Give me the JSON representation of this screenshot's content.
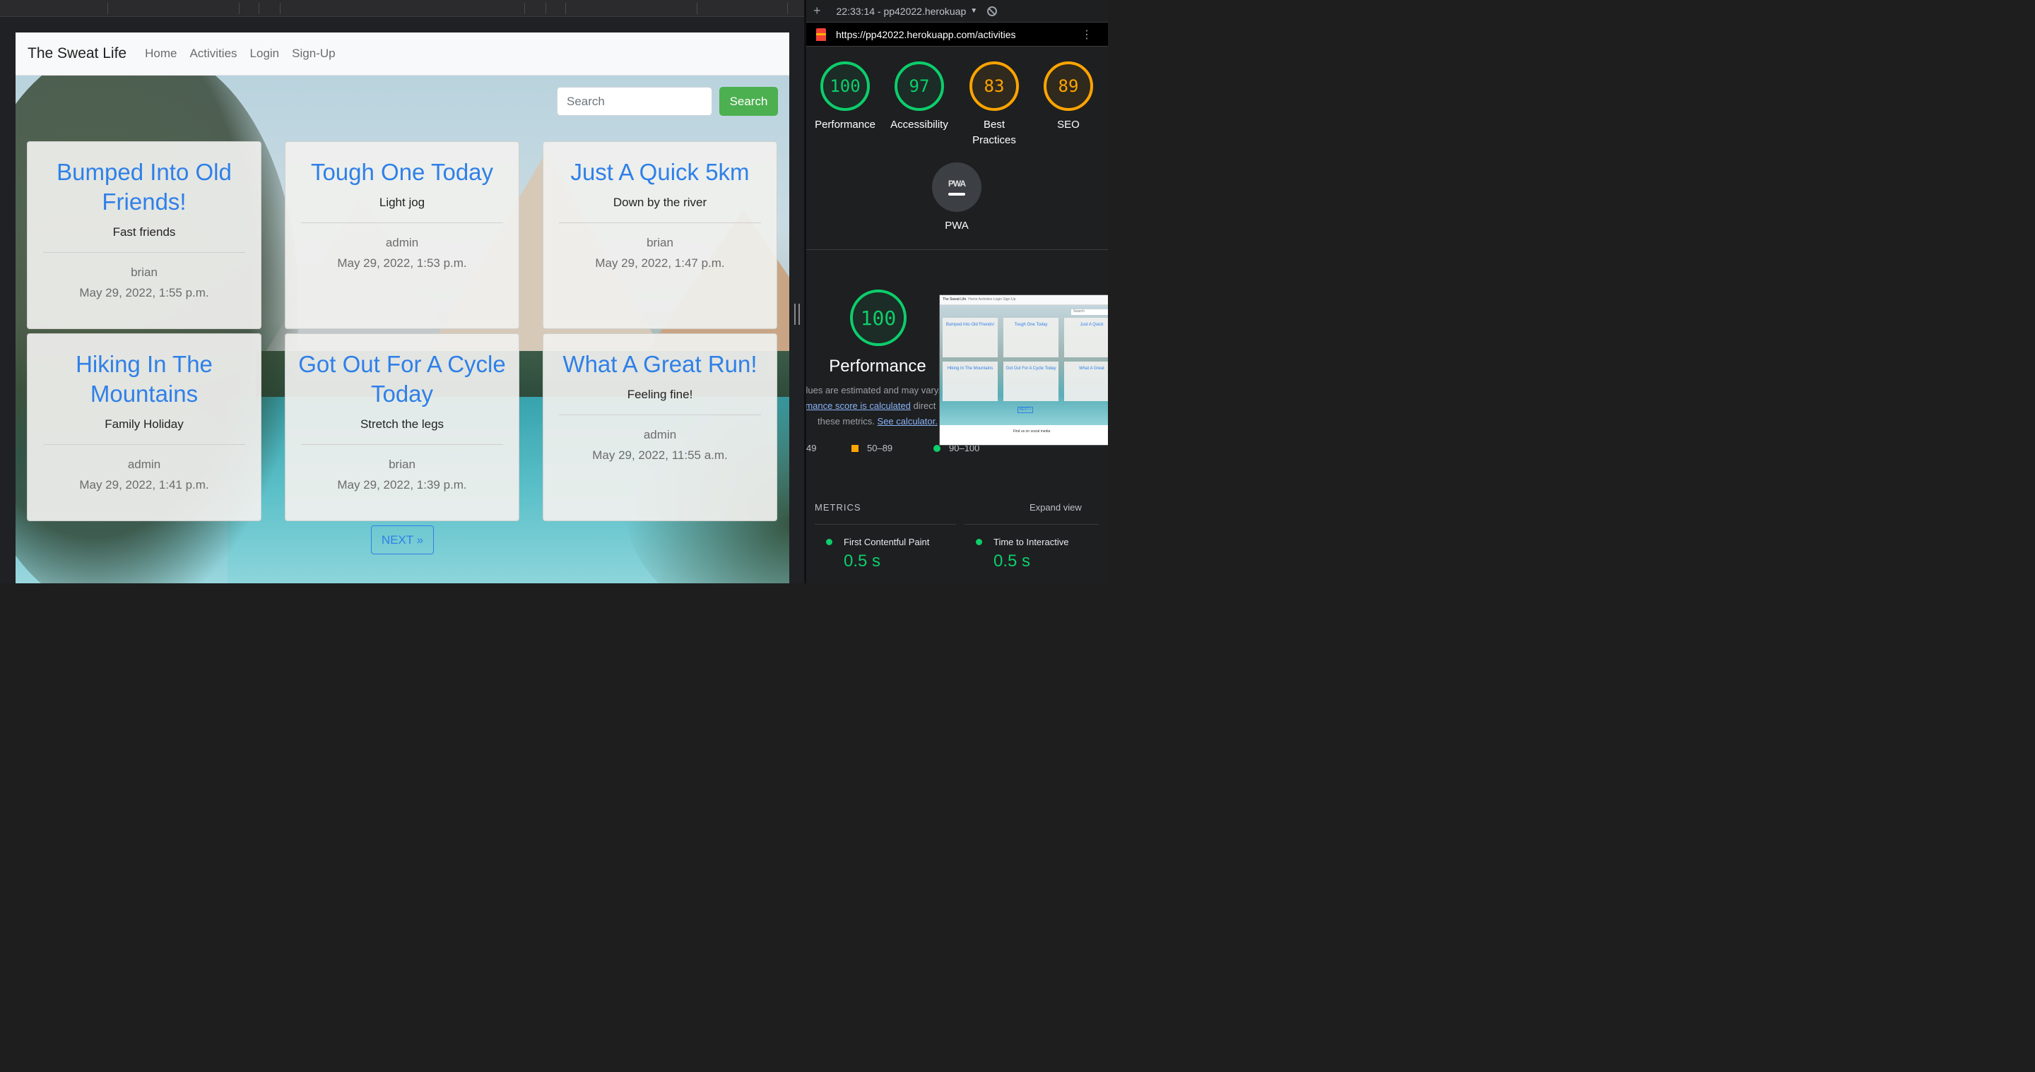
{
  "app": {
    "brand": "The Sweat Life",
    "nav": [
      "Home",
      "Activities",
      "Login",
      "Sign-Up"
    ],
    "search": {
      "placeholder": "Search",
      "button_label": "Search"
    },
    "cards": [
      {
        "title": "Bumped Into Old Friends!",
        "subtitle": "Fast friends",
        "author": "brian",
        "date": "May 29, 2022, 1:55 p.m."
      },
      {
        "title": "Tough One Today",
        "subtitle": "Light jog",
        "author": "admin",
        "date": "May 29, 2022, 1:53 p.m."
      },
      {
        "title": "Just A Quick 5km",
        "subtitle": "Down by the river",
        "author": "brian",
        "date": "May 29, 2022, 1:47 p.m."
      },
      {
        "title": "Hiking In The Mountains",
        "subtitle": "Family Holiday",
        "author": "admin",
        "date": "May 29, 2022, 1:41 p.m."
      },
      {
        "title": "Got Out For A Cycle Today",
        "subtitle": "Stretch the legs",
        "author": "brian",
        "date": "May 29, 2022, 1:39 p.m."
      },
      {
        "title": "What A Great Run!",
        "subtitle": "Feeling fine!",
        "author": "admin",
        "date": "May 29, 2022, 11:55 a.m."
      }
    ],
    "next_label": "NEXT »"
  },
  "lighthouse": {
    "plus": "+",
    "run_time": "22:33:14 - pp42022.herokuap",
    "caret": "▼",
    "url": "https://pp42022.herokuapp.com/activities",
    "kebab": "⋮",
    "scores": [
      {
        "value": "100",
        "label": "Performance",
        "color": "#0cce6b"
      },
      {
        "value": "97",
        "label": "Accessibility",
        "color": "#0cce6b"
      },
      {
        "value": "83",
        "label": "Best Practices",
        "color": "#ffa400"
      },
      {
        "value": "89",
        "label": "SEO",
        "color": "#ffa400"
      }
    ],
    "pwa": {
      "badge": "PWA",
      "label": "PWA"
    },
    "performance": {
      "score": "100",
      "title": "Performance",
      "note_line1": "lues are estimated and may vary.",
      "note_link1": "rmance score is calculated",
      "note_after_link1": " direct",
      "note_line3": "these metrics. ",
      "note_link2": "See calculator.",
      "legend_low": "49",
      "legend_mid": "50–89",
      "legend_high": "90–100"
    },
    "thumbnail": {
      "brand": "The Sweat Life",
      "nav": "Home   Activities   Login   Sign-Up",
      "search": "Search",
      "cards": [
        "Bumped Into Old Friends!",
        "Tough One Today",
        "Just A Quick",
        "Hiking In The Mountains",
        "Got Out For A Cycle Today",
        "What A Great"
      ],
      "next": "NEXT »",
      "footer": "Find us on social media"
    },
    "metrics": {
      "heading": "METRICS",
      "expand": "Expand view",
      "items": [
        {
          "name": "First Contentful Paint",
          "value": "0.5 s"
        },
        {
          "name": "Time to Interactive",
          "value": "0.5 s"
        }
      ]
    }
  }
}
